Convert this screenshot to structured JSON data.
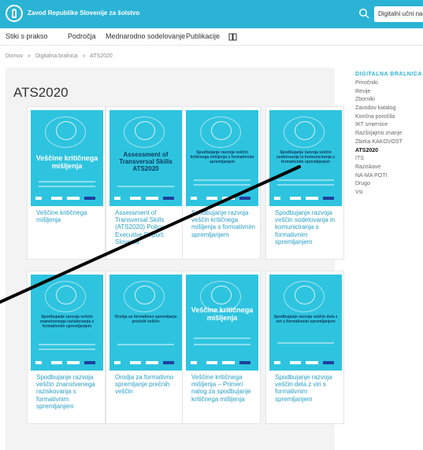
{
  "header": {
    "org_name": "Zavod Republike Slovenije za šolstvo",
    "search_placeholder": "Digitalni učni načrt"
  },
  "nav": {
    "items": [
      "Stiki s prakso",
      "Področja",
      "Mednarodno sodelovanje",
      "Publikacije"
    ],
    "extra_icon": "book-icon"
  },
  "breadcrumb": [
    "Domov",
    "»",
    "Digitalna bralnica",
    "»",
    "ATS2020"
  ],
  "page_title": "ATS2020",
  "cards": [
    {
      "cover_title": "Veščine kritičnega mišljenja",
      "label": "Veščine kritičnega mišljenja"
    },
    {
      "cover_title": "Assessment of Transversal Skills ATS2020",
      "label": "Assessment of Transversal Skills (ATS2020) Policy Executive Report: Slovenia"
    },
    {
      "cover_title": "Spodbujanje razvoja veščin kritičnega mišljenja s formativnim spremljanjem",
      "label": "Spodbujanje razvoja veščin kritičnega mišljenja s formativnim spremljanjem"
    },
    {
      "cover_title": "Spodbujanje razvoja veščin sodelovanja in komuniciranja s formativnim spremljanjem",
      "label": "Spodbujanje razvoja veščin sodelovanja in komuniciranja s formativnim spremljanjem"
    },
    {
      "cover_title": "Spodbujanje razvoja veščin znanstvenega raziskovanja s formativnim spremljanjem",
      "label": "Spodbujanje razvoja veščin znanstvenega raziskovanja s formativnim spremljanjem"
    },
    {
      "cover_title": "Orodja za formativno spremljanje prečnih veščin",
      "label": "Orodja za formativno spremljanje prečnih veščin"
    },
    {
      "cover_title": "Veščine kritičnega mišljenja",
      "label": "Veščine kritičnega mišljenja – Primeri nalog za spodbujanje kritičnega mišljenja"
    },
    {
      "cover_title": "Spodbujanje razvoja veščin dela z viri s formativnim spremljanjem",
      "label": "Spodbujanje razvoja veščin dela z viri s formativnim spremljanjem"
    }
  ],
  "sidebar": {
    "heading": "DIGITALNA BRALNICA",
    "items": [
      "Priročniki",
      "Revije",
      "Zborniki",
      "Zavodov katalog",
      "Končna poročila",
      "IKT smernice",
      "Razširjajmo znanje",
      "Zbirka KAKOVOST",
      "ATS2020",
      "ITS",
      "Raziskave",
      "NA-MA POTI",
      "Drugo",
      "Vsi"
    ],
    "active": "ATS2020"
  },
  "colors": {
    "brand": "#2ab3d4",
    "link": "#2a9fc4",
    "cover": "#2ec4df"
  }
}
